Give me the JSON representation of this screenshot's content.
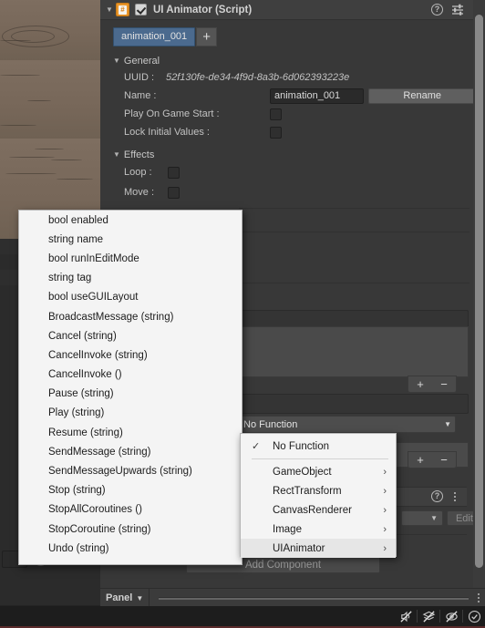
{
  "component": {
    "title": "UI Animator (Script)",
    "enabled_checkbox": true,
    "foldout": "▼",
    "script_icon_glyph": "#",
    "help_glyph": "?",
    "icons": {
      "help": "help-icon",
      "preset": "preset-slider-icon",
      "kebab": "kebab-menu-icon"
    }
  },
  "tabs": {
    "animation_tab_label": "animation_001",
    "add_tab_label": "+"
  },
  "general": {
    "section_label": "General",
    "foldout": "▼",
    "uuid_label": "UUID :",
    "uuid_value": "52f130fe-de34-4f9d-8a3b-6d062393223e",
    "name_label": "Name :",
    "name_value": "animation_001",
    "rename_button": "Rename",
    "play_on_game_start_label": "Play On Game Start :",
    "play_on_game_start_value": false,
    "lock_initial_values_label": "Lock Initial Values :",
    "lock_initial_values_value": false
  },
  "effects": {
    "section_label": "Effects",
    "foldout": "▼",
    "loop_label": "Loop :",
    "loop_value": false,
    "move_label": "Move :",
    "move_value": false
  },
  "event_list": {
    "plus_label": "+",
    "minus_label": "−",
    "function_field_value": "No Function",
    "function_field_caret": "▼"
  },
  "method_menu": {
    "items": [
      "bool enabled",
      "string name",
      "bool runInEditMode",
      "string tag",
      "bool useGUILayout",
      "BroadcastMessage (string)",
      "Cancel (string)",
      "CancelInvoke (string)",
      "CancelInvoke ()",
      "Pause (string)",
      "Play (string)",
      "Resume (string)",
      "SendMessage (string)",
      "SendMessageUpwards (string)",
      "Stop (string)",
      "StopAllCoroutines ()",
      "StopCoroutine (string)",
      "Undo (string)"
    ]
  },
  "type_menu": {
    "checkmark": "✓",
    "submenu_arrow": "›",
    "items": [
      {
        "label": "No Function",
        "checked": true,
        "submenu": false,
        "selected": false
      },
      {
        "label": "GameObject",
        "checked": false,
        "submenu": true,
        "selected": false
      },
      {
        "label": "RectTransform",
        "checked": false,
        "submenu": true,
        "selected": false
      },
      {
        "label": "CanvasRenderer",
        "checked": false,
        "submenu": true,
        "selected": false
      },
      {
        "label": "Image",
        "checked": false,
        "submenu": true,
        "selected": false
      },
      {
        "label": "UIAnimator",
        "checked": false,
        "submenu": true,
        "selected": true
      }
    ]
  },
  "lower_inspector": {
    "edit_button_label": "Edit...",
    "add_component_label": "Add Component",
    "help_glyph": "?"
  },
  "bottom_bar": {
    "panel_label": "Panel",
    "panel_caret": "▼",
    "status_icons": [
      "mute-audio-icon",
      "layers-off-icon",
      "visibility-off-icon",
      "check-circle-icon"
    ]
  },
  "colors": {
    "panel_bg": "#383838",
    "header_bg": "#3f3f3f",
    "tab_accent": "#4b6a8e",
    "script_icon": "#e8952a",
    "menu_bg": "#f4f4f4",
    "menu_text": "#1c1c1c",
    "menu_selected": "#e6e6e6",
    "game_wood": "#7a6a5d"
  }
}
